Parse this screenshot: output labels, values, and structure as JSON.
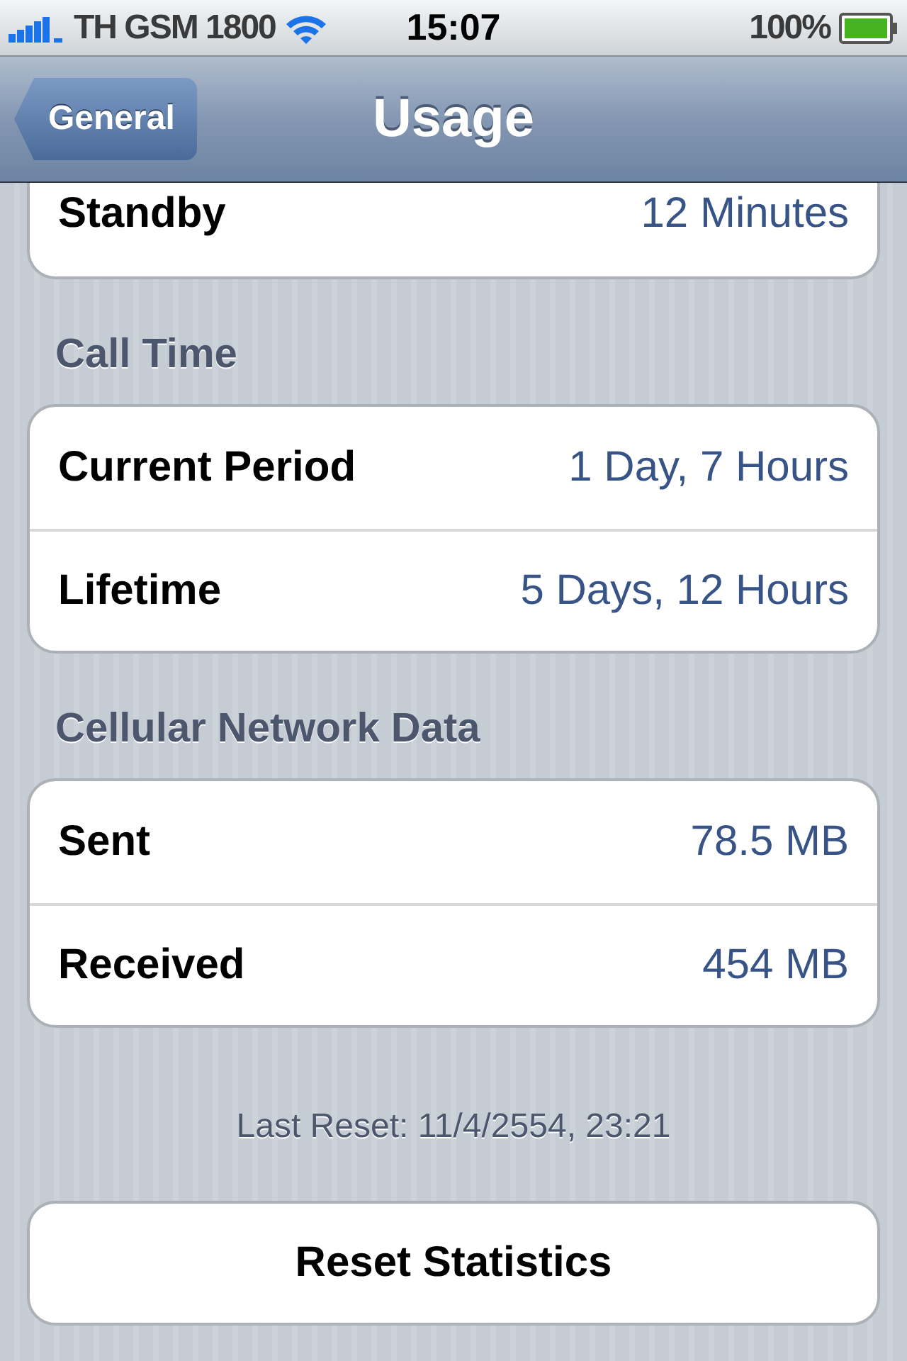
{
  "status_bar": {
    "carrier": "TH GSM 1800",
    "time": "15:07",
    "battery": "100%"
  },
  "nav": {
    "back": "General",
    "title": "Usage"
  },
  "groups": [
    {
      "rows": [
        {
          "label": "Standby",
          "value": "12 Minutes"
        }
      ]
    },
    {
      "header": "Call Time",
      "rows": [
        {
          "label": "Current Period",
          "value": "1 Day, 7 Hours"
        },
        {
          "label": "Lifetime",
          "value": "5 Days, 12 Hours"
        }
      ]
    },
    {
      "header": "Cellular Network Data",
      "rows": [
        {
          "label": "Sent",
          "value": "78.5 MB"
        },
        {
          "label": "Received",
          "value": "454 MB"
        }
      ]
    }
  ],
  "footer": "Last Reset: 11/4/2554, 23:21",
  "button": "Reset Statistics"
}
